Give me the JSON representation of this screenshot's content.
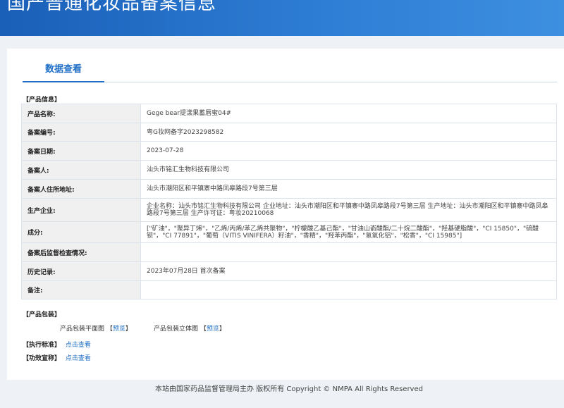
{
  "banner": {
    "title": "国产普通化妆品备案信息"
  },
  "tab": {
    "label": "数据查看"
  },
  "product_info": {
    "section_title": "【产品信息】",
    "rows": [
      {
        "label": "产品名称:",
        "value": "Gege bear提漾果蓄唇蜜04#"
      },
      {
        "label": "备案编号:",
        "value": "粤G妆网备字2023298582"
      },
      {
        "label": "备案日期:",
        "value": "2023-07-28"
      },
      {
        "label": "备案人:",
        "value": "汕头市铭汇生物科技有限公司"
      },
      {
        "label": "备案人住所地址:",
        "value": "汕头市潮阳区和平镇寨中路凤皋路段7号第三层"
      },
      {
        "label": "生产企业:",
        "value": "企业名称：汕头市铭汇生物科技有限公司 企业地址：汕头市潮阳区和平镇寨中路凤皋路段7号第三层 生产地址：汕头市潮阳区和平镇寨中路凤皋路段7号第三层 生产许可证：粤妆20210068"
      },
      {
        "label": "成分:",
        "value": "[\"矿油\"，\"聚异丁烯\"，\"乙烯/丙烯/苯乙烯共聚物\"，\"柠檬酸乙基己酯\"，\"甘油山嵛酸酯/二十烷二酸酯\"，\"羟基硬脂酸\"，\"CI 15850\"，\"硫酸钡\"，\"CI 77891\"，\"葡萄（VITIS VINIFERA）籽油\"，\"香精\"，\"羟苯丙酯\"，\"氢氧化铝\"，\"松香\"，\"CI 15985\"]"
      },
      {
        "label": "备案后监督检查情况:",
        "value": ""
      },
      {
        "label": "历史记录:",
        "value": "2023年07月28日 首次备案"
      },
      {
        "label": "备注:",
        "value": ""
      }
    ]
  },
  "packaging": {
    "section_title": "【产品包装】",
    "flat_label": "产品包装平面图",
    "flat_link": "预览",
    "solid_label": "产品包装立体图",
    "solid_link": "预览",
    "bracket_open": "【",
    "bracket_close": "】"
  },
  "standard": {
    "label": "【执行标准】",
    "link": "点击查看"
  },
  "efficacy": {
    "label": "【功效宣称】",
    "link": "点击查看"
  },
  "footer": {
    "text": "本站由国家药品监督管理局主办 版权所有 Copyright © NMPA All Rights Reserved"
  }
}
